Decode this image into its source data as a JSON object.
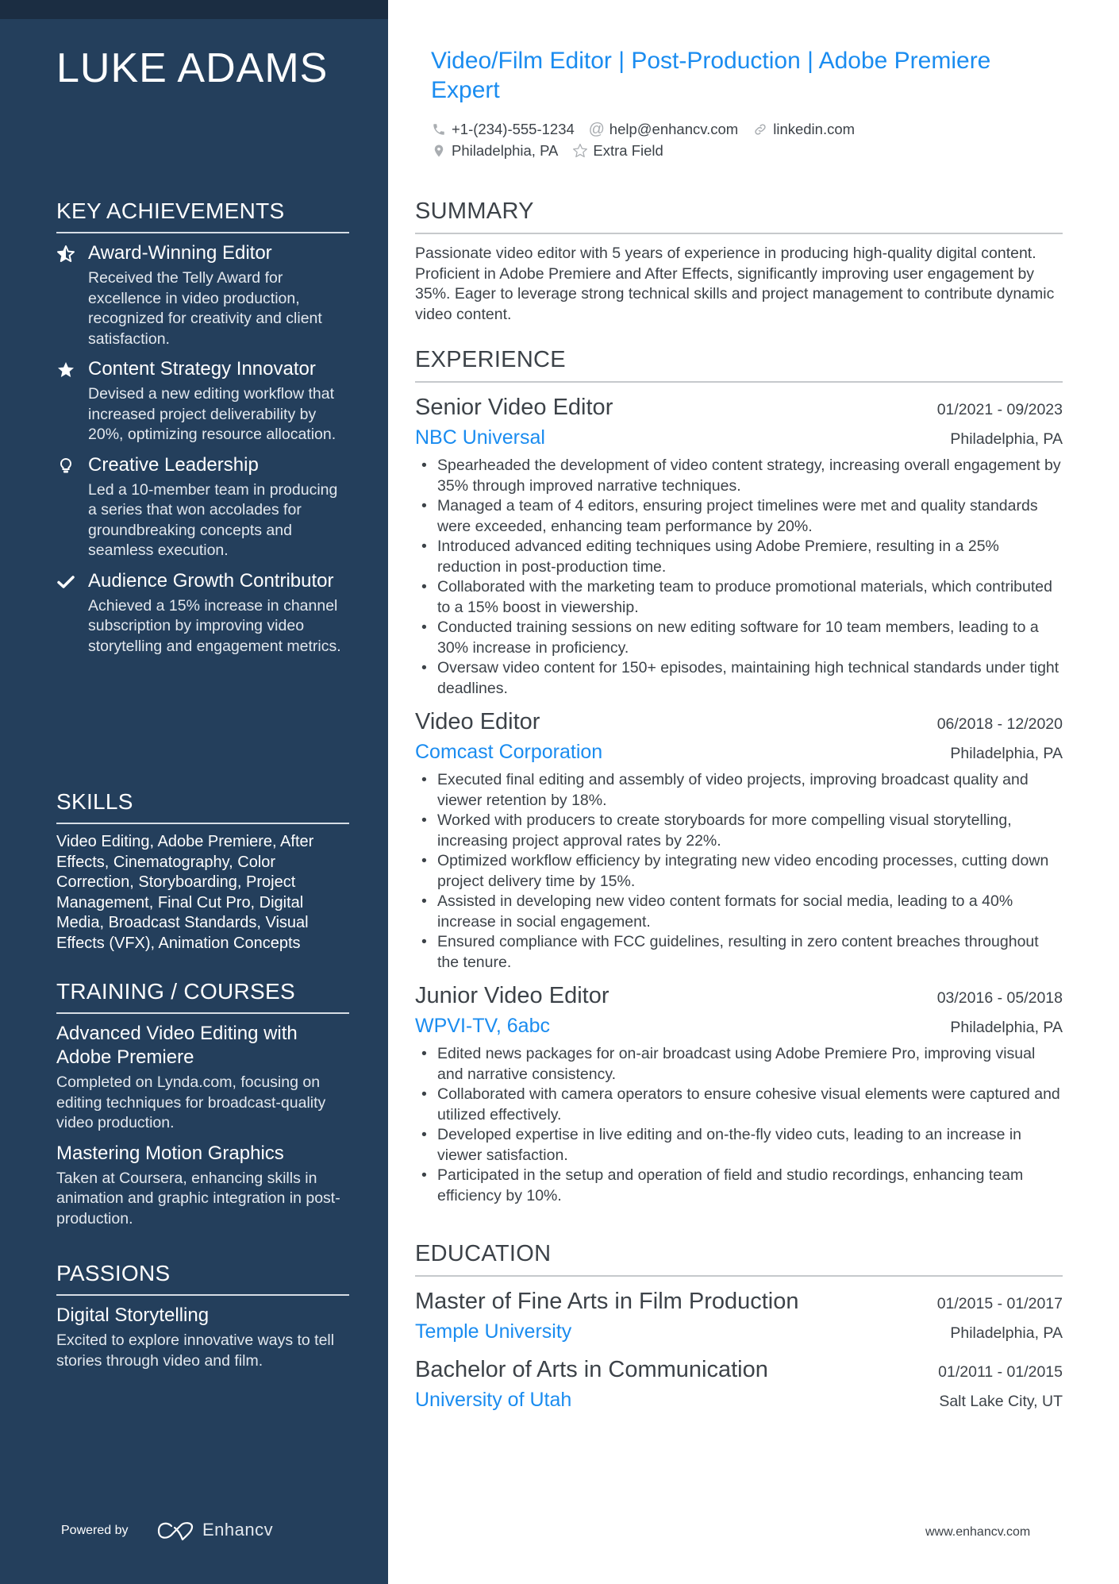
{
  "sidebar": {
    "name": "LUKE ADAMS",
    "achievements_heading": "KEY ACHIEVEMENTS",
    "achievements": [
      {
        "icon": "star-half-icon",
        "title": "Award-Winning Editor",
        "desc": "Received the Telly Award for excellence in video production, recognized for creativity and client satisfaction."
      },
      {
        "icon": "star-icon",
        "title": "Content Strategy Innovator",
        "desc": "Devised a new editing workflow that increased project deliverability by 20%, optimizing resource allocation."
      },
      {
        "icon": "lightbulb-icon",
        "title": "Creative Leadership",
        "desc": "Led a 10-member team in producing a series that won accolades for groundbreaking concepts and seamless execution."
      },
      {
        "icon": "checkmark-icon",
        "title": "Audience Growth Contributor",
        "desc": "Achieved a 15% increase in channel subscription by improving video storytelling and engagement metrics."
      }
    ],
    "skills_heading": "SKILLS",
    "skills_text": "Video Editing, Adobe Premiere, After Effects, Cinematography, Color Correction, Storyboarding, Project Management, Final Cut Pro, Digital Media, Broadcast Standards, Visual Effects (VFX), Animation Concepts",
    "training_heading": "TRAINING / COURSES",
    "courses": [
      {
        "title": "Advanced Video Editing with Adobe Premiere",
        "desc": "Completed on Lynda.com, focusing on editing techniques for broadcast-quality video production."
      },
      {
        "title": "Mastering Motion Graphics",
        "desc": "Taken at Coursera, enhancing skills in animation and graphic integration in post-production."
      }
    ],
    "passions_heading": "PASSIONS",
    "passions": [
      {
        "title": "Digital Storytelling",
        "desc": "Excited to explore innovative ways to tell stories through video and film."
      }
    ],
    "powered_by": "Powered by",
    "brand": "Enhancv"
  },
  "header": {
    "headline": "Video/Film Editor | Post-Production | Adobe Premiere Expert",
    "contacts": {
      "phone": "+1-(234)-555-1234",
      "email": "help@enhancv.com",
      "link": "linkedin.com",
      "location": "Philadelphia, PA",
      "extra": "Extra Field"
    }
  },
  "summary": {
    "heading": "SUMMARY",
    "text": "Passionate video editor with 5 years of experience in producing high-quality digital content. Proficient in Adobe Premiere and After Effects, significantly improving user engagement by 35%. Eager to leverage strong technical skills and project management to contribute dynamic video content."
  },
  "experience": {
    "heading": "EXPERIENCE",
    "jobs": [
      {
        "title": "Senior Video Editor",
        "dates": "01/2021 - 09/2023",
        "company": "NBC Universal",
        "location": "Philadelphia, PA",
        "bullets": [
          "Spearheaded the development of video content strategy, increasing overall engagement by 35% through improved narrative techniques.",
          "Managed a team of 4 editors, ensuring project timelines were met and quality standards were exceeded, enhancing team performance by 20%.",
          "Introduced advanced editing techniques using Adobe Premiere, resulting in a 25% reduction in post-production time.",
          "Collaborated with the marketing team to produce promotional materials, which contributed to a 15% boost in viewership.",
          "Conducted training sessions on new editing software for 10 team members, leading to a 30% increase in proficiency.",
          "Oversaw video content for 150+ episodes, maintaining high technical standards under tight deadlines."
        ]
      },
      {
        "title": "Video Editor",
        "dates": "06/2018 - 12/2020",
        "company": "Comcast Corporation",
        "location": "Philadelphia, PA",
        "bullets": [
          "Executed final editing and assembly of video projects, improving broadcast quality and viewer retention by 18%.",
          "Worked with producers to create storyboards for more compelling visual storytelling, increasing project approval rates by 22%.",
          "Optimized workflow efficiency by integrating new video encoding processes, cutting down project delivery time by 15%.",
          "Assisted in developing new video content formats for social media, leading to a 40% increase in social engagement.",
          "Ensured compliance with FCC guidelines, resulting in zero content breaches throughout the tenure."
        ]
      },
      {
        "title": "Junior Video Editor",
        "dates": "03/2016 - 05/2018",
        "company": "WPVI-TV, 6abc",
        "location": "Philadelphia, PA",
        "bullets": [
          "Edited news packages for on-air broadcast using Adobe Premiere Pro, improving visual and narrative consistency.",
          "Collaborated with camera operators to ensure cohesive visual elements were captured and utilized effectively.",
          "Developed expertise in live editing and on-the-fly video cuts, leading to an increase in viewer satisfaction.",
          "Participated in the setup and operation of field and studio recordings, enhancing team efficiency by 10%."
        ]
      }
    ]
  },
  "education": {
    "heading": "EDUCATION",
    "items": [
      {
        "degree": "Master of Fine Arts in Film Production",
        "dates": "01/2015 - 01/2017",
        "school": "Temple University",
        "location": "Philadelphia, PA"
      },
      {
        "degree": "Bachelor of Arts in Communication",
        "dates": "01/2011 - 01/2015",
        "school": "University of Utah",
        "location": "Salt Lake City, UT"
      }
    ]
  },
  "footer": {
    "url": "www.enhancv.com"
  }
}
